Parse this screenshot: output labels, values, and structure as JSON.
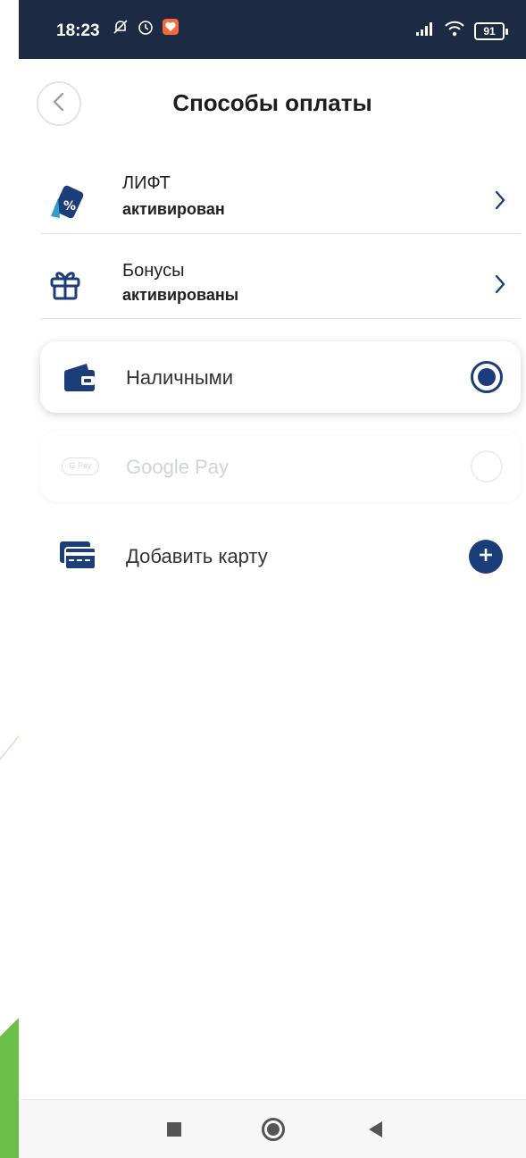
{
  "status_bar": {
    "time": "18:23",
    "battery": "91",
    "icons": [
      "muted-bell-icon",
      "alarm-icon",
      "app-notification-icon",
      "signal-icon",
      "wifi-icon",
      "battery-icon"
    ]
  },
  "header": {
    "title": "Способы оплаты",
    "back_icon": "chevron-left-icon"
  },
  "menu_rows": [
    {
      "title": "ЛИФТ",
      "status": "активирован",
      "icon": "discount-card-icon"
    },
    {
      "title": "Бонусы",
      "status": "активированы",
      "icon": "gift-icon"
    }
  ],
  "payment_options": [
    {
      "label": "Наличными",
      "selected": true,
      "enabled": true,
      "icon": "wallet-icon"
    },
    {
      "label": "Google Pay",
      "badge": "G Pay",
      "selected": false,
      "enabled": false,
      "icon": "gpay-icon"
    }
  ],
  "add_card": {
    "label": "Добавить карту",
    "icon": "credit-card-icon"
  },
  "colors": {
    "accent": "#1b3e7a",
    "status_bar": "#1c2a44",
    "deco_green": "#6cc04a"
  },
  "nav_bar": [
    "recent-apps-icon",
    "home-icon",
    "back-icon"
  ]
}
